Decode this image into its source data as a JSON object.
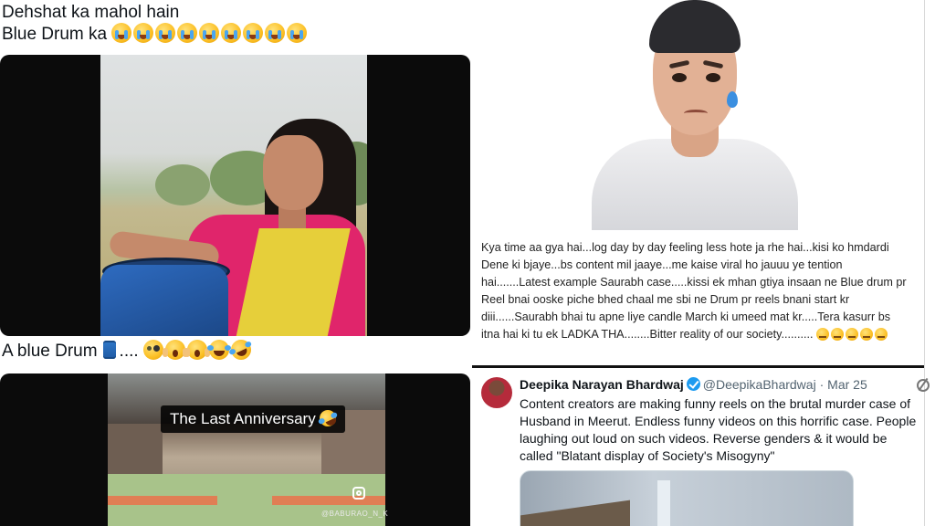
{
  "left": {
    "post1": {
      "line1": "Dehshat ka mahol hain",
      "line2": "Blue Drum ka",
      "emojis": [
        "loudly-crying-face",
        "loudly-crying-face",
        "loudly-crying-face",
        "loudly-crying-face",
        "loudly-crying-face",
        "loudly-crying-face",
        "loudly-crying-face",
        "loudly-crying-face",
        "loudly-crying-face"
      ]
    },
    "post2": {
      "text": "A blue Drum",
      "drum_icon": "blue-drum-icon",
      "dots": "....",
      "emojis": [
        "face-with-monocle",
        "face-screaming-in-fear",
        "face-screaming-in-fear",
        "face-with-tears-of-joy",
        "rolling-on-the-floor-laughing"
      ]
    },
    "video2": {
      "overlay_title": "The Last Anniversary",
      "overlay_emoji": "rolling-on-the-floor-laughing",
      "watermark": "@BABURAO_N_K",
      "platform_icon": "instagram-icon"
    }
  },
  "right": {
    "caption": {
      "text": "Kya time aa gya hai...log day by day feeling less hote ja rhe hai...kisi ko hmdardi Dene ki bjaye...bs content mil jaaye...me kaise viral ho jauuu ye tention hai.......Latest example Saurabh case.....kissi ek mhan gtiya insaan ne Blue drum pr Reel bnai ooske piche bhed chaal me sbi ne Drum pr reels bnani start kr diii......Saurabh bhai tu apne liye candle March ki umeed mat kr.....Tera kasurr bs itna hai ki tu ek LADKA THA........Bitter reality of our society..........",
      "emojis": [
        "pensive-face",
        "pensive-face",
        "pensive-face",
        "pensive-face",
        "pensive-face"
      ]
    },
    "tweet": {
      "name": "Deepika Narayan Bhardwaj",
      "handle": "@DeepikaBhardwaj",
      "sep": " · ",
      "date": "Mar 25",
      "body": "Content creators are making funny reels on the brutal murder case of Husband in Meerut. Endless funny videos on this horrific case. People laughing out loud on such videos. Reverse genders & it would be called \"Blatant display of Society's Misogyny\""
    }
  },
  "colors": {
    "verified": "#1d9bf0",
    "handle": "#536471",
    "drum_blue": "#2f78c9"
  }
}
